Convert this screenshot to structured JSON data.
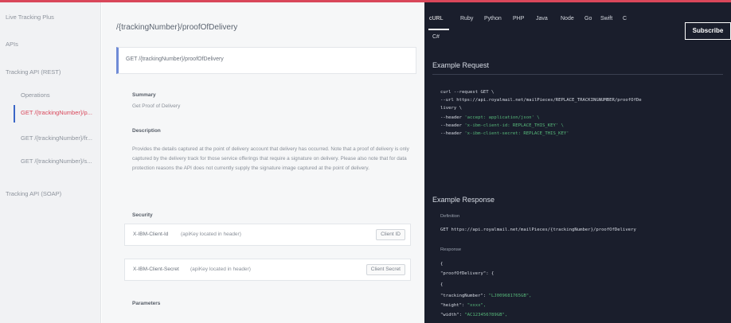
{
  "sidebar": {
    "items": [
      {
        "label": "Live Tracking Plus"
      },
      {
        "label": "APIs"
      },
      {
        "label": "Tracking API (REST)"
      },
      {
        "label": "Operations"
      },
      {
        "label": "GET /{trackingNumber}/p..."
      },
      {
        "label": "GET /{trackingNumber}/fr..."
      },
      {
        "label": "GET /{trackingNumber}/s..."
      },
      {
        "label": "Tracking API (SOAP)"
      }
    ]
  },
  "main": {
    "title": "/{trackingNumber}/proofOfDelivery",
    "endpoint": "GET /{trackingNumber}/proofOfDelivery",
    "summary_label": "Summary",
    "summary_text": "Get Proof of Delivery",
    "description_label": "Description",
    "description_text": "Provides the details captured at the point of delivery account that delivery has occurred. Note that a proof of delivery is only captured by the delivery track for those service offerings that require a signature on delivery. Please also note that for data protection reasons the API does not currently supply the signature image captured at the point of delivery.",
    "security_label": "Security",
    "security": [
      {
        "key": "X-IBM-Client-Id",
        "value": "(apiKey located in header)",
        "button": "Client ID"
      },
      {
        "key": "X-IBM-Client-Secret",
        "value": "(apiKey located in header)",
        "button": "Client Secret"
      }
    ],
    "parameters_label": "Parameters"
  },
  "code_panel": {
    "languages": [
      "cURL",
      "Ruby",
      "Python",
      "PHP",
      "Java",
      "Node",
      "Go",
      "Swift",
      "C"
    ],
    "languages_row2": [
      "C#"
    ],
    "subscribe_label": "Subscribe",
    "example_request_label": "Example Request",
    "request_lines": [
      {
        "text": "curl --request GET \\",
        "green": ""
      },
      {
        "text": "  --url https://api.royalmail.net/mailPieces/REPLACE_TRACKINGNUMBER/proofOfDe",
        "green": ""
      },
      {
        "text": "livery \\",
        "green": ""
      },
      {
        "text": "  --header ",
        "green": "'accept: application/json' \\"
      },
      {
        "text": "  --header ",
        "green": "'x-ibm-client-id: REPLACE_THIS_KEY' \\"
      },
      {
        "text": "  --header ",
        "green": "'x-ibm-client-secret: REPLACE_THIS_KEY'"
      }
    ],
    "example_response_label": "Example Response",
    "definition_label": "Definition",
    "definition_text": "GET https://api.royalmail.net/mailPieces/{trackingNumber}/proofOfDelivery",
    "response_label": "Response",
    "response_lines": [
      {
        "text": "{",
        "green": ""
      },
      {
        "text": "  \"proofOfDelivery\": {",
        "green": ""
      },
      {
        "text": "    {",
        "green": ""
      },
      {
        "text": "    \"trackingNumber\": ",
        "green": "\"LJ009681765GB\","
      },
      {
        "text": "    \"height\": ",
        "green": "\"xxxx\","
      },
      {
        "text": "    \"width\": ",
        "green": "\"AC123456789GB\","
      }
    ]
  },
  "colors": {
    "accent": "#d9475a",
    "active_bar": "#3a66c7",
    "code_bg": "#1a1e2c",
    "code_green": "#57b87a"
  }
}
